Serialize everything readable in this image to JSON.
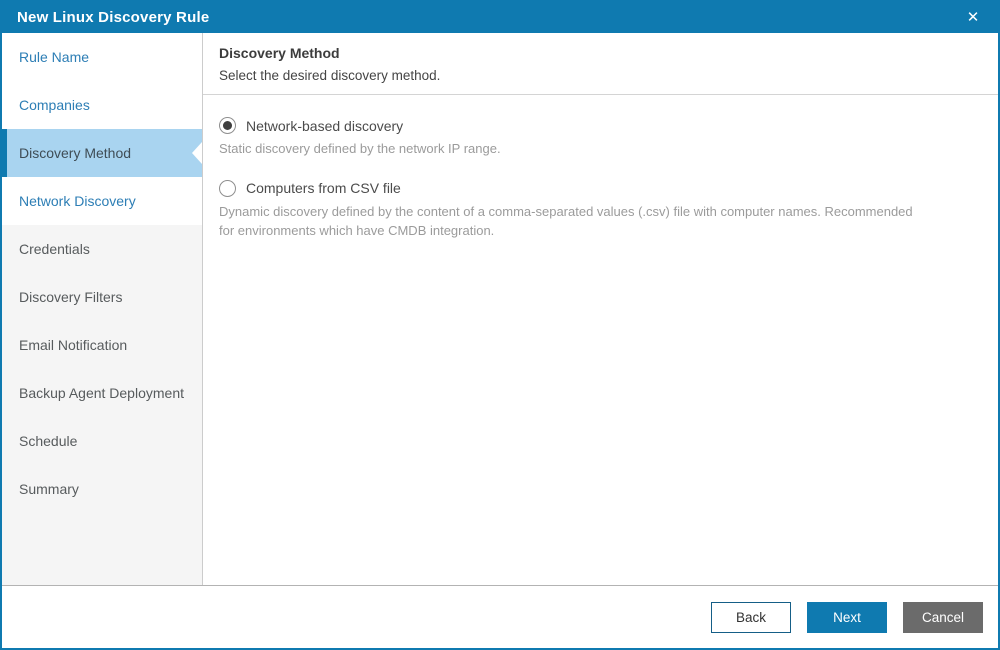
{
  "window": {
    "title": "New Linux Discovery Rule",
    "close_icon": "✕"
  },
  "sidebar": {
    "items": [
      {
        "label": "Rule Name",
        "state": "link"
      },
      {
        "label": "Companies",
        "state": "link"
      },
      {
        "label": "Discovery Method",
        "state": "active"
      },
      {
        "label": "Network Discovery",
        "state": "link"
      },
      {
        "label": "Credentials",
        "state": "disabled"
      },
      {
        "label": "Discovery Filters",
        "state": "disabled"
      },
      {
        "label": "Email Notification",
        "state": "disabled"
      },
      {
        "label": "Backup Agent Deployment",
        "state": "disabled"
      },
      {
        "label": "Schedule",
        "state": "disabled"
      },
      {
        "label": "Summary",
        "state": "disabled"
      }
    ]
  },
  "content": {
    "heading": "Discovery Method",
    "subheading": "Select the desired discovery method.",
    "options": [
      {
        "label": "Network-based discovery",
        "description": "Static discovery defined by the network IP range.",
        "selected": true
      },
      {
        "label": "Computers from CSV file",
        "description": "Dynamic discovery defined by the content of a comma-separated values (.csv) file with computer names. Recommended for environments which have CMDB integration.",
        "selected": false
      }
    ]
  },
  "footer": {
    "back_label": "Back",
    "next_label": "Next",
    "cancel_label": "Cancel"
  },
  "colors": {
    "brand_blue": "#0f7ab0",
    "highlight_blue": "#a9d4f0",
    "link_blue": "#2d7eb5",
    "disabled_bg": "#f5f5f5",
    "cancel_gray": "#6b6b6b"
  }
}
